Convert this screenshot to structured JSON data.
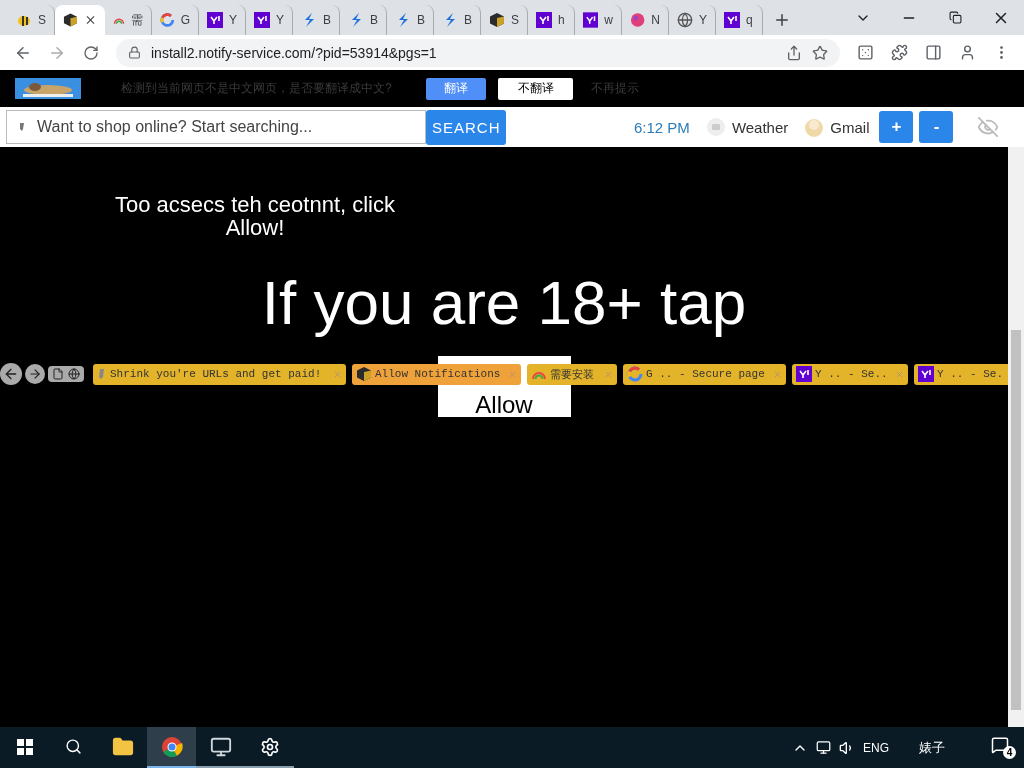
{
  "browser": {
    "tabs": [
      {
        "title": "S",
        "kind": "bee",
        "selected": false
      },
      {
        "kind": "cube",
        "selected": true
      },
      {
        "title": "需",
        "kind": "rainbow",
        "selected": false
      },
      {
        "title": "G",
        "kind": "ring",
        "selected": false
      },
      {
        "title": "Y",
        "kind": "square",
        "selected": false
      },
      {
        "title": "Y",
        "kind": "square",
        "selected": false
      },
      {
        "title": "B",
        "kind": "bolt",
        "selected": false
      },
      {
        "title": "B",
        "kind": "bolt",
        "selected": false
      },
      {
        "title": "B",
        "kind": "bolt",
        "selected": false
      },
      {
        "title": "B",
        "kind": "bolt",
        "selected": false
      },
      {
        "title": "S",
        "kind": "cube",
        "selected": false
      },
      {
        "title": "h",
        "kind": "square",
        "selected": false
      },
      {
        "title": "w",
        "kind": "square",
        "selected": false
      },
      {
        "title": "N",
        "kind": "ball",
        "selected": false
      },
      {
        "title": "Y",
        "kind": "globe",
        "selected": false
      },
      {
        "title": "q",
        "kind": "square",
        "selected": false
      }
    ],
    "address": "install2.notify-service.com/?pid=53914&pgs=1"
  },
  "translate_bar": {
    "message": "检测到当前网页不是中文网页，是否要翻译成中文?",
    "buttons": [
      {
        "label": "翻译",
        "kind": "primary"
      },
      {
        "label": "不翻译",
        "kind": "secondary"
      },
      {
        "label": "不再提示",
        "kind": "link"
      }
    ]
  },
  "toolbar": {
    "search": {
      "placeholder": "Want to shop online? Start searching...",
      "button": "SEARCH"
    },
    "time": "6:12 PM",
    "links": [
      {
        "label": "Weather",
        "kind": "cloud"
      },
      {
        "label": "Gmail",
        "kind": "avatar"
      }
    ],
    "zoom_buttons": [
      "+",
      "-"
    ]
  },
  "page": {
    "notice": "Too acsecs teh ceotnnt, click Allow!",
    "headline": "If you are 18+ tap",
    "button": "Allow"
  },
  "overlay_tabs": [
    {
      "title": "Shrink you're URLs and get paid!",
      "kind": "pencil",
      "highlighted": false,
      "closable": true
    },
    {
      "title": "Allow Notifications",
      "kind": "cube",
      "highlighted": true,
      "closable": true
    },
    {
      "title": "需要安装",
      "kind": "rainbow",
      "highlighted": false,
      "closable": true
    },
    {
      "title": "G .. - Secure page",
      "kind": "ring",
      "highlighted": false,
      "closable": true
    },
    {
      "title": "Y .. - Se..",
      "kind": "square",
      "highlighted": false,
      "closable": true
    },
    {
      "title": "Y .. - Se.",
      "kind": "square",
      "highlighted": false,
      "closable": false
    }
  ],
  "taskbar": {
    "apps": [
      {
        "kind": "folder",
        "selected": false,
        "running": false
      },
      {
        "kind": "browser",
        "selected": true,
        "running": true
      },
      {
        "kind": "monitor",
        "selected": false,
        "running": true
      },
      {
        "kind": "settings",
        "selected": false,
        "running": true
      }
    ],
    "language": "ENG",
    "user": "婊子",
    "notifications": "4"
  }
}
